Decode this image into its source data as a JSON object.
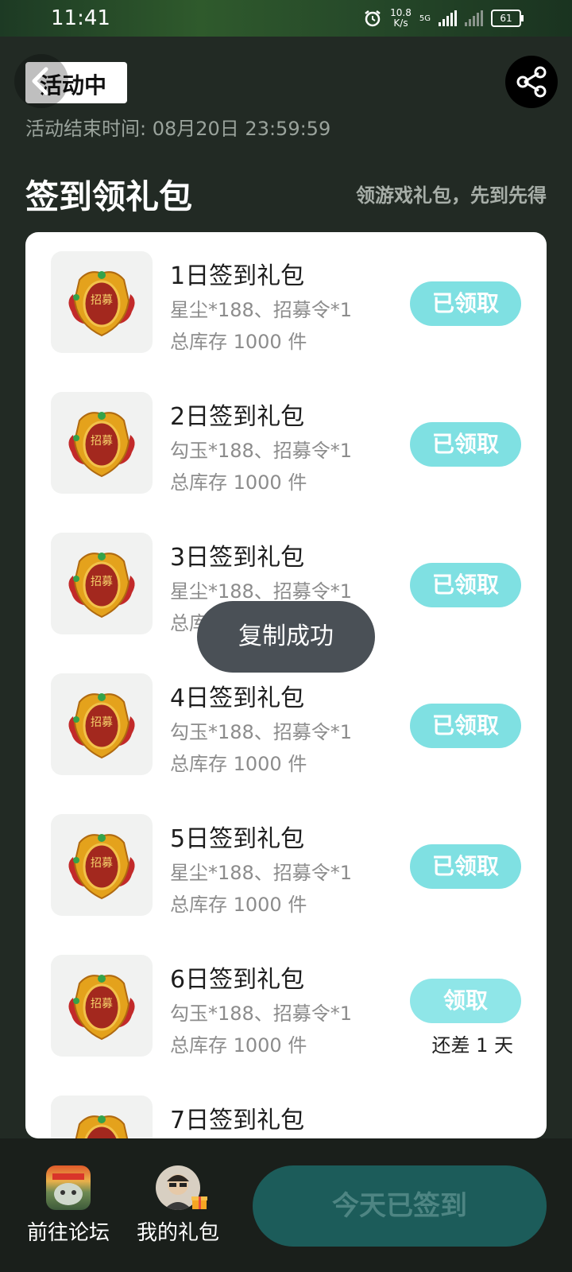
{
  "status_bar": {
    "time": "11:41",
    "net_speed": "10.8",
    "net_unit": "K/s",
    "network": "5G",
    "battery": "61"
  },
  "header": {
    "title": "活动中",
    "end_time": "活动结束时间: 08月20日 23:59:59"
  },
  "section": {
    "title": "签到领礼包",
    "subtitle": "领游戏礼包，先到先得"
  },
  "gifts": [
    {
      "name": "1日签到礼包",
      "items": "星尘*188、招募令*1",
      "stock": "总库存 1000 件",
      "button": "已领取"
    },
    {
      "name": "2日签到礼包",
      "items": "勾玉*188、招募令*1",
      "stock": "总库存 1000 件",
      "button": "已领取"
    },
    {
      "name": "3日签到礼包",
      "items": "星尘*188、招募令*1",
      "stock": "总库存 1000 件",
      "button": "已领取"
    },
    {
      "name": "4日签到礼包",
      "items": "勾玉*188、招募令*1",
      "stock": "总库存 1000 件",
      "button": "已领取"
    },
    {
      "name": "5日签到礼包",
      "items": "星尘*188、招募令*1",
      "stock": "总库存 1000 件",
      "button": "已领取"
    },
    {
      "name": "6日签到礼包",
      "items": "勾玉*188、招募令*1",
      "stock": "总库存 1000 件",
      "button": "领取",
      "remain": "还差 1 天"
    },
    {
      "name": "7日签到礼包"
    }
  ],
  "token_text": "招募",
  "toast": "复制成功",
  "bottom": {
    "forum": "前往论坛",
    "my_gifts": "我的礼包",
    "signed": "今天已签到"
  },
  "colors": {
    "claimed_button": "#7fe0e2",
    "signed_button": "#1c5c5a",
    "toast_bg": "#4a5056"
  }
}
